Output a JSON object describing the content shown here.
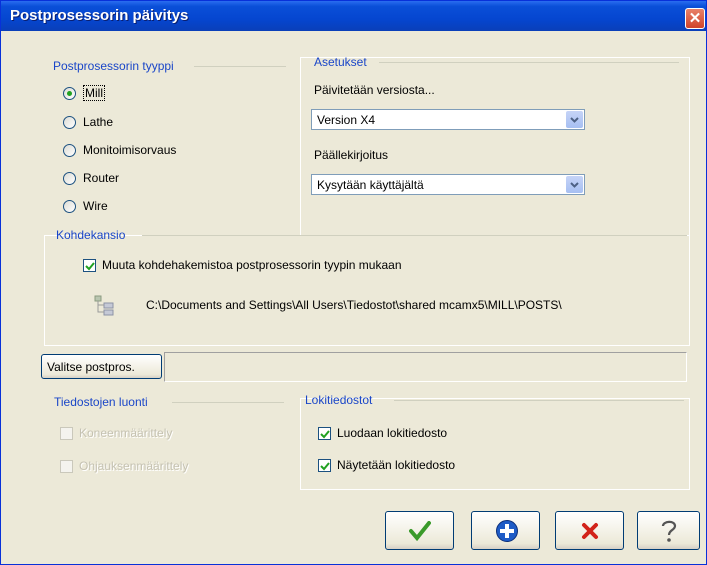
{
  "window": {
    "title": "Postprosessorin päivitys",
    "close_glyph": "✕"
  },
  "post_type": {
    "title": "Postprosessorin tyyppi",
    "options": [
      {
        "label": "Mill",
        "selected": true
      },
      {
        "label": "Lathe",
        "selected": false
      },
      {
        "label": "Monitoimisorvaus",
        "selected": false
      },
      {
        "label": "Router",
        "selected": false
      },
      {
        "label": "Wire",
        "selected": false
      }
    ]
  },
  "settings": {
    "title": "Asetukset",
    "version_label": "Päivitetään versiosta...",
    "version_value": "Version X4",
    "overwrite_label": "Päällekirjoitus",
    "overwrite_value": "Kysytään käyttäjältä"
  },
  "target_folder": {
    "title": "Kohdekansio",
    "checkbox_label": "Muuta kohdehakemistoa postprosessorin tyypin mukaan",
    "checkbox_checked": true,
    "path": "C:\\Documents and Settings\\All Users\\Tiedostot\\shared mcamx5\\MILL\\POSTS\\"
  },
  "select_post": {
    "button_label": "Valitse postpros.",
    "value": ""
  },
  "file_creation": {
    "title": "Tiedostojen luonti",
    "items": [
      {
        "label": "Koneenmäärittely",
        "checked": false,
        "enabled": false
      },
      {
        "label": "Ohjauksenmäärittely",
        "checked": false,
        "enabled": false
      }
    ]
  },
  "log_files": {
    "title": "Lokitiedostot",
    "items": [
      {
        "label": "Luodaan lokitiedosto",
        "checked": true
      },
      {
        "label": "Näytetään lokitiedosto",
        "checked": true
      }
    ]
  },
  "footer": {
    "buttons": [
      {
        "icon": "checkmark-icon",
        "color": "#3a9a2a"
      },
      {
        "icon": "plus-icon",
        "color": "#1e5bc6"
      },
      {
        "icon": "cancel-icon",
        "color": "#d2231a"
      },
      {
        "icon": "help-icon",
        "color": "#555555"
      }
    ]
  }
}
